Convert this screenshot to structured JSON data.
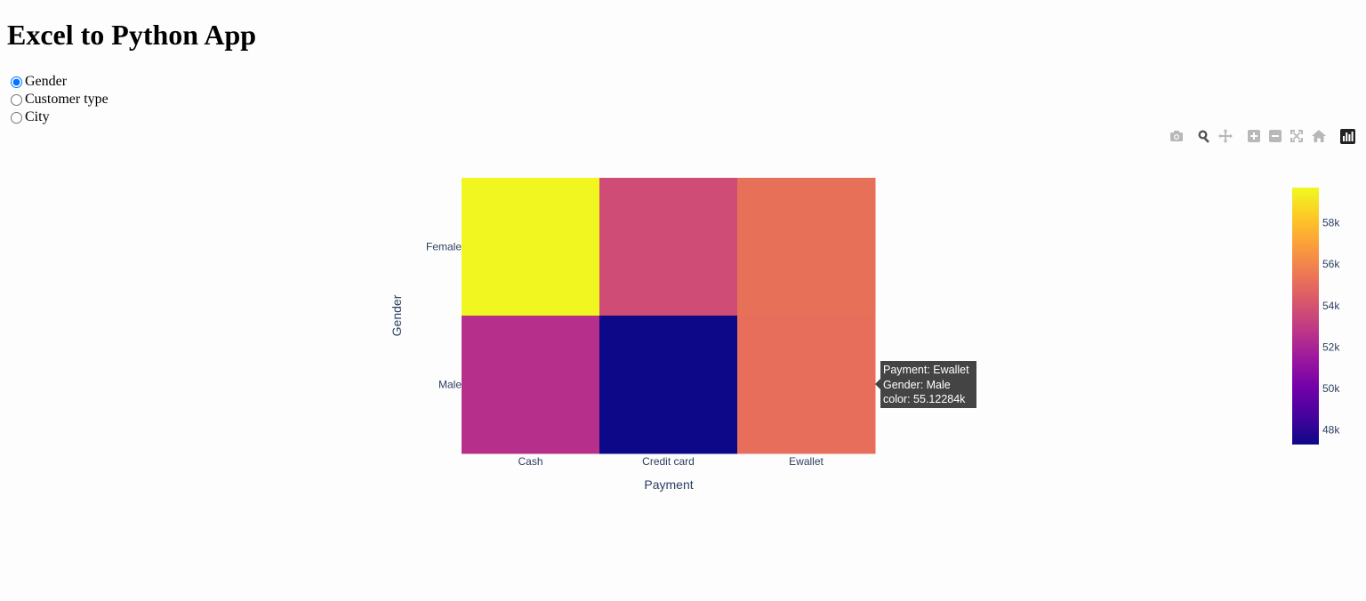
{
  "page": {
    "title": "Excel to Python App"
  },
  "selector": {
    "options": [
      "Gender",
      "Customer type",
      "City"
    ],
    "selected": "Gender"
  },
  "modebar": {
    "icons": [
      "camera-icon",
      "zoom-icon",
      "pan-icon",
      "zoom-in-icon",
      "zoom-out-icon",
      "autoscale-icon",
      "home-icon",
      "plotly-logo-icon"
    ]
  },
  "chart_data": {
    "type": "heatmap",
    "x": [
      "Cash",
      "Credit card",
      "Ewallet"
    ],
    "y": [
      "Female",
      "Male"
    ],
    "z": [
      [
        59600,
        53700,
        55200
      ],
      [
        52500,
        47300,
        55122.84
      ]
    ],
    "xlabel": "Payment",
    "ylabel": "Gender",
    "colorscale": [
      "#0d0887",
      "#46039f",
      "#7201a8",
      "#9c179e",
      "#bd3786",
      "#d8576b",
      "#ed7953",
      "#fb9f3a",
      "#fdca26",
      "#f0f921"
    ],
    "colorbar": {
      "range": [
        47300,
        59700
      ],
      "ticks": [
        48000,
        50000,
        52000,
        54000,
        56000,
        58000
      ],
      "ticktext": [
        "48k",
        "50k",
        "52k",
        "54k",
        "56k",
        "58k"
      ]
    },
    "hover": {
      "lines": [
        "Payment: Ewallet",
        "Gender: Male",
        "color: 55.12284k"
      ]
    }
  }
}
